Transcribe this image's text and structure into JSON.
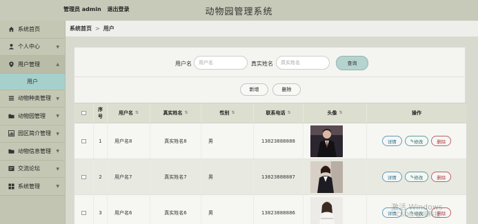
{
  "header": {
    "admin_label": "管理员 admin",
    "logout_label": "退出登录",
    "system_title": "动物园管理系统"
  },
  "sidebar": {
    "items": [
      {
        "label": "系统首页",
        "icon": "home-icon"
      },
      {
        "label": "个人中心",
        "icon": "user-icon"
      },
      {
        "label": "用户管理",
        "icon": "location-icon",
        "sub": "用户"
      },
      {
        "label": "动物种类管理",
        "icon": "list-icon"
      },
      {
        "label": "动物园管理",
        "icon": "folder-icon"
      },
      {
        "label": "园区简介管理",
        "icon": "chart-icon"
      },
      {
        "label": "动物信息管理",
        "icon": "folder-icon"
      },
      {
        "label": "交流论坛",
        "icon": "forum-icon"
      },
      {
        "label": "系统管理",
        "icon": "grid-icon"
      }
    ]
  },
  "breadcrumb": {
    "home": "系统首页",
    "separator": ">",
    "current": "用户"
  },
  "search": {
    "username_label": "用户名",
    "username_placeholder": "用户名",
    "realname_label": "真实姓名",
    "realname_placeholder": "真实姓名",
    "search_button": "查询"
  },
  "actions": {
    "add_button": "新增",
    "delete_button": "删除"
  },
  "table": {
    "headers": {
      "index": "序号",
      "username": "用户名",
      "realname": "真实姓名",
      "gender": "性别",
      "phone": "联系电话",
      "avatar": "头像",
      "ops": "操作"
    },
    "rows": [
      {
        "index": "1",
        "username": "用户名8",
        "realname": "真实姓名8",
        "gender": "男",
        "phone": "13823888888"
      },
      {
        "index": "2",
        "username": "用户名7",
        "realname": "真实姓名7",
        "gender": "男",
        "phone": "13823888887"
      },
      {
        "index": "3",
        "username": "用户名6",
        "realname": "真实姓名6",
        "gender": "男",
        "phone": "13823888886"
      }
    ],
    "op_labels": {
      "detail": "详情",
      "edit": "修改",
      "delete": "删除"
    }
  },
  "watermark": {
    "line1": "激活 Windows",
    "line2": "CSDN @翊科技"
  },
  "colors": {
    "sidebar_bg": "#c4c7b3",
    "active_sub_bg": "#a6d0cc",
    "header_bg": "#dcdfcf",
    "search_button_bg": "#b5d3cf"
  }
}
